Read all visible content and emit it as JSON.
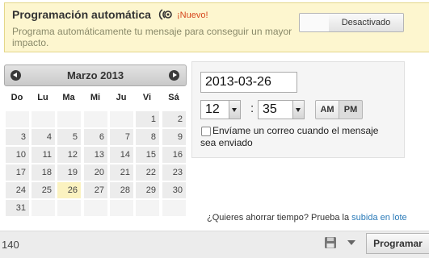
{
  "banner": {
    "title": "Programación automática",
    "icon": "schedule-waves-icon",
    "new_label": "¡Nuevo!",
    "description": "Programa automáticamente tu mensaje para conseguir un mayor impacto.",
    "toggle_label": "Desactivado"
  },
  "calendar": {
    "month_label": "Marzo 2013",
    "weekdays": [
      "Do",
      "Lu",
      "Ma",
      "Mi",
      "Ju",
      "Vi",
      "Sá"
    ],
    "weeks": [
      [
        "",
        "",
        "",
        "",
        "",
        "1",
        "2"
      ],
      [
        "3",
        "4",
        "5",
        "6",
        "7",
        "8",
        "9"
      ],
      [
        "10",
        "11",
        "12",
        "13",
        "14",
        "15",
        "16"
      ],
      [
        "17",
        "18",
        "19",
        "20",
        "21",
        "22",
        "23"
      ],
      [
        "24",
        "25",
        "26",
        "27",
        "28",
        "29",
        "30"
      ],
      [
        "31",
        "",
        "",
        "",
        "",
        "",
        ""
      ]
    ],
    "today": "26"
  },
  "schedule": {
    "date_value": "2013-03-26",
    "hour_value": "12",
    "minute_value": "35",
    "am_label": "AM",
    "pm_label": "PM",
    "selected_period": "PM",
    "email_label": "Envíame un correo cuando el mensaje sea enviado",
    "email_checked": false
  },
  "bulk": {
    "prompt": "¿Quieres ahorrar tiempo? Prueba la ",
    "link": "subida en lote"
  },
  "footer": {
    "char_count": "140",
    "save_icon": "floppy-disk-icon",
    "submit_label": "Programar"
  },
  "colors": {
    "banner_bg": "#fdf6cf",
    "new_badge": "#d6451c",
    "today_highlight": "#fbf2c0",
    "link": "#2a7ab8"
  }
}
